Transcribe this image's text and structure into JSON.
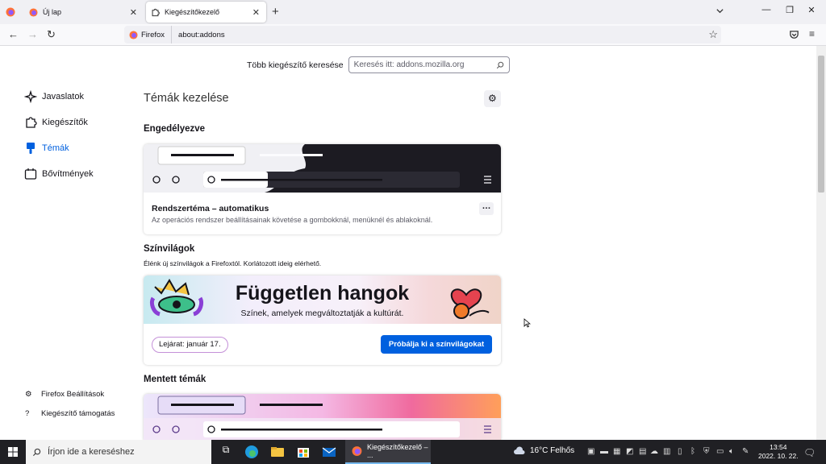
{
  "tabs": [
    {
      "label": "Új lap"
    },
    {
      "label": "Kiegészítőkezelő"
    }
  ],
  "nav": {
    "identity": "Firefox",
    "url": "about:addons"
  },
  "search": {
    "label": "Több kiegészítő keresése",
    "placeholder": "Keresés itt: addons.mozilla.org"
  },
  "sidebar": {
    "categories": [
      {
        "label": "Javaslatok",
        "icon": "sparkle-icon"
      },
      {
        "label": "Kiegészítők",
        "icon": "puzzle-icon"
      },
      {
        "label": "Témák",
        "icon": "brush-icon",
        "selected": true
      },
      {
        "label": "Bővítmények",
        "icon": "plugin-icon"
      }
    ],
    "footer": [
      {
        "label": "Firefox Beállítások",
        "icon": "gear-icon"
      },
      {
        "label": "Kiegészítő támogatás",
        "icon": "help-icon"
      }
    ]
  },
  "main": {
    "heading": "Témák kezelése",
    "enabled_heading": "Engedélyezve",
    "system_theme": {
      "name": "Rendszertéma – automatikus",
      "description": "Az operációs rendszer beállításainak követése a gombokknál, menüknél és ablakoknál."
    },
    "colorways": {
      "heading": "Színvilágok",
      "description": "Élénk új színvilágok a Firefoxtól. Korlátozott ideig elérhető.",
      "banner_title": "Független hangok",
      "banner_subtitle": "Színek, amelyek megváltoztatják a kultúrát.",
      "expiry": "Lejárat: január 17.",
      "try_button": "Próbálja ki a színvilágokat"
    },
    "saved_heading": "Mentett témák"
  },
  "taskbar": {
    "search_placeholder": "Írjon ide a kereséshez",
    "active_app": "Kiegészítőkezelő – ...",
    "weather": "16°C  Felhős",
    "time": "13:54",
    "date": "2022. 10. 22."
  },
  "colors": {
    "accent": "#0060df",
    "dark_theme": "#1c1b22"
  }
}
